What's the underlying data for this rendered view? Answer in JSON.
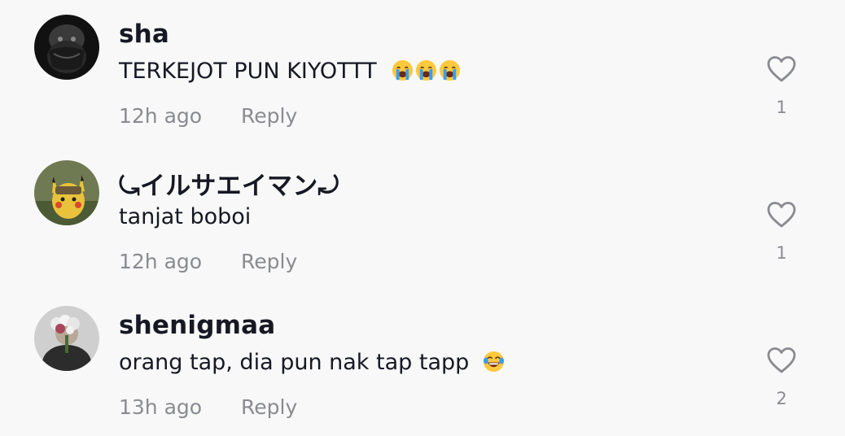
{
  "comments": [
    {
      "username": "sha",
      "text": "TERKEJOT PUN KIYOTTT",
      "emojis": [
        "crying-face",
        "crying-face",
        "crying-face"
      ],
      "time": "12h ago",
      "reply_label": "Reply",
      "likes": "1"
    },
    {
      "username": "⤿イルサエイマン⤾",
      "text": "tanjat boboi",
      "emojis": [],
      "time": "12h ago",
      "reply_label": "Reply",
      "likes": "1"
    },
    {
      "username": "shenigmaa",
      "text": "orang tap, dia pun nak tap tapp",
      "emojis": [
        "joy-face"
      ],
      "time": "13h ago",
      "reply_label": "Reply",
      "likes": "2"
    }
  ],
  "colors": {
    "background": "#f8f8f8",
    "username": "#161823",
    "meta": "#8a8b91",
    "emoji_face": "#ffc83d",
    "emoji_tear": "#3b9cf0"
  },
  "icons": {
    "like": "heart-outline-icon",
    "crying": "loudly-crying-face-emoji",
    "laughing": "face-with-tears-of-joy-emoji"
  }
}
